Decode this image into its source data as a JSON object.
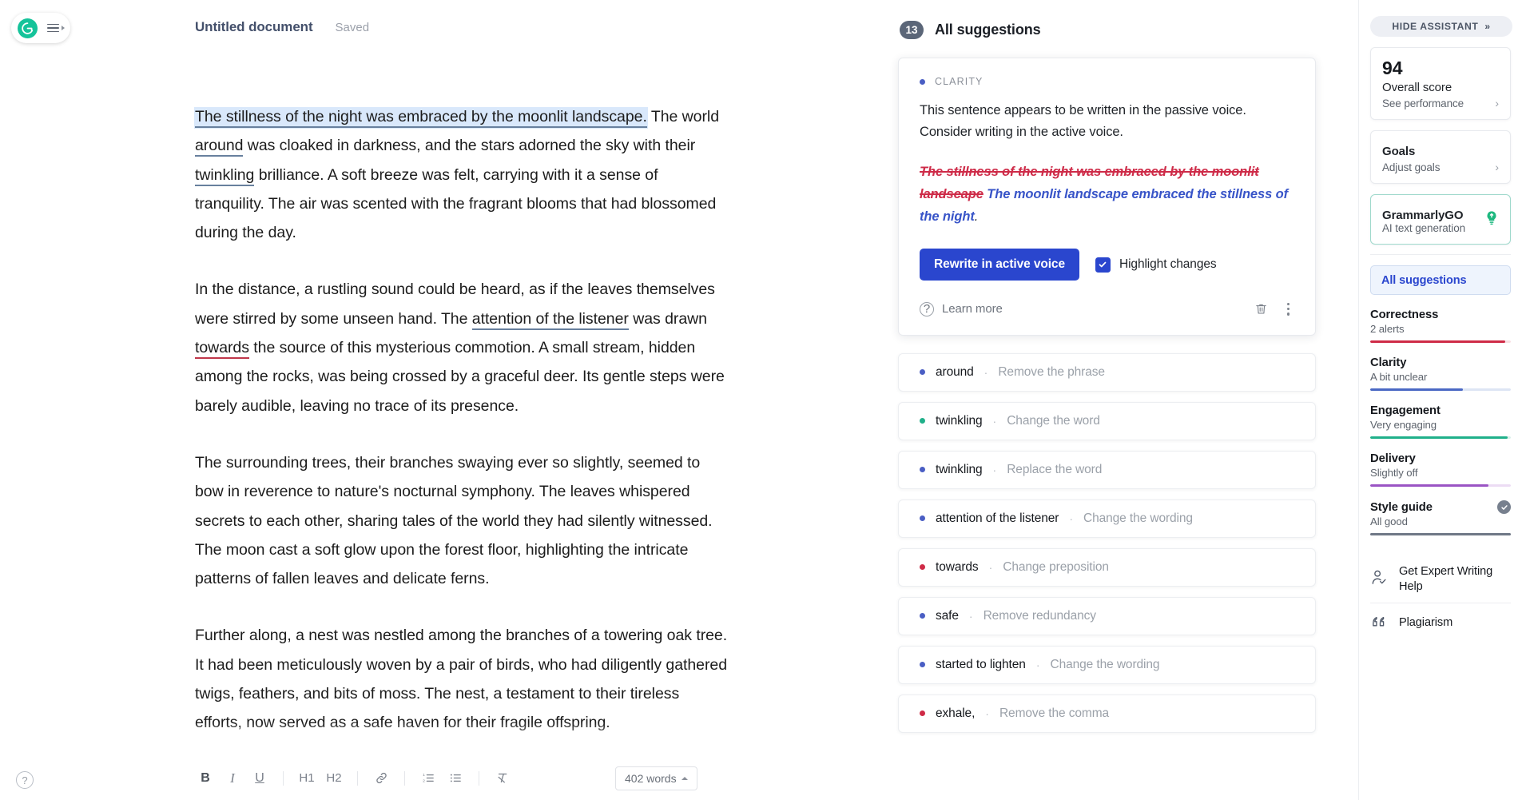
{
  "brand": {
    "logo_letter": "G",
    "logo_color": "#15c39a"
  },
  "document": {
    "title": "Untitled document",
    "save_status": "Saved",
    "paragraphs": [
      {
        "segments": [
          {
            "text": "The stillness of the night was embraced by the moonlit landscape.",
            "style": "highlight-underline"
          },
          {
            "text": " The world ",
            "style": "plain"
          },
          {
            "text": "around",
            "style": "underline-blue"
          },
          {
            "text": " was cloaked in darkness, and the stars adorned the sky with their ",
            "style": "plain"
          },
          {
            "text": "twinkling",
            "style": "underline-blue"
          },
          {
            "text": " brilliance. A soft breeze was felt, carrying with it a sense of tranquility. The air was scented with the fragrant blooms that had blossomed during the day.",
            "style": "plain"
          }
        ]
      },
      {
        "segments": [
          {
            "text": "In the distance, a rustling sound could be heard, as if the leaves themselves were stirred by some unseen hand. The ",
            "style": "plain"
          },
          {
            "text": "attention of the listener",
            "style": "underline-blue"
          },
          {
            "text": " was drawn ",
            "style": "plain"
          },
          {
            "text": "towards",
            "style": "underline-red"
          },
          {
            "text": " the source of this mysterious commotion. A small stream, hidden among the rocks, was being crossed by a graceful deer. Its gentle steps were barely audible, leaving no trace of its presence.",
            "style": "plain"
          }
        ]
      },
      {
        "segments": [
          {
            "text": "The surrounding trees, their branches swaying ever so slightly, seemed to bow in reverence to nature's nocturnal symphony. The leaves whispered secrets to each other, sharing tales of the world they had silently witnessed. The moon cast a soft glow upon the forest floor, highlighting the intricate patterns of fallen leaves and delicate ferns.",
            "style": "plain"
          }
        ]
      },
      {
        "segments": [
          {
            "text": "Further along, a nest was nestled among the branches of a towering oak tree. It had been meticulously woven by a pair of birds, who had diligently gathered twigs, feathers, and bits of moss. The nest, a testament to their tireless efforts, now served as a safe haven for their fragile offspring.",
            "style": "plain"
          }
        ]
      }
    ]
  },
  "toolbar": {
    "bold": "B",
    "italic": "I",
    "underline": "U",
    "h1": "H1",
    "h2": "H2",
    "link_icon": "link-icon",
    "numbered_list_icon": "numbered-list-icon",
    "bullet_list_icon": "bullet-list-icon",
    "clear_format_icon": "clear-formatting-icon",
    "word_count": "402 words",
    "help_icon": "?"
  },
  "suggestions_panel": {
    "count": "13",
    "title": "All suggestions",
    "main_card": {
      "category": "CLARITY",
      "category_color": "#4a5ec4",
      "description": "This sentence appears to be written in the passive voice. Consider writing in the active voice.",
      "diff_old": "The stillness of the night was embraced by the moonlit landscape",
      "diff_new": "The moonlit landscape embraced the stillness of the night",
      "diff_tail": ".",
      "primary_button": "Rewrite in active voice",
      "checkbox_label": "Highlight changes",
      "checkbox_checked": true,
      "learn_more": "Learn more",
      "delete_icon": "trash-icon",
      "more_icon": "kebab-menu-icon"
    },
    "items": [
      {
        "word": "around",
        "sep": "·",
        "action": "Remove the phrase",
        "dot": "#4a5ec4"
      },
      {
        "word": "twinkling",
        "sep": "·",
        "action": "Change the word",
        "dot": "#20b08a"
      },
      {
        "word": "twinkling",
        "sep": "·",
        "action": "Replace the word",
        "dot": "#4a5ec4"
      },
      {
        "word": "attention of the listener",
        "sep": "·",
        "action": "Change the wording",
        "dot": "#4a5ec4"
      },
      {
        "word": "towards",
        "sep": "·",
        "action": "Change preposition",
        "dot": "#cf2b47"
      },
      {
        "word": "safe",
        "sep": "·",
        "action": "Remove redundancy",
        "dot": "#4a5ec4"
      },
      {
        "word": "started to lighten",
        "sep": "·",
        "action": "Change the wording",
        "dot": "#4a5ec4"
      },
      {
        "word": "exhale,",
        "sep": "·",
        "action": "Remove the comma",
        "dot": "#cf2b47"
      }
    ]
  },
  "assistant": {
    "hide_label": "HIDE ASSISTANT",
    "hide_chevron": "»",
    "overall": {
      "score": "94",
      "title": "Overall score",
      "sub": "See performance",
      "chevron": "›"
    },
    "goals": {
      "title": "Goals",
      "sub": "Adjust goals",
      "chevron": "›"
    },
    "grammarlygo": {
      "title": "GrammarlyGO",
      "sub": "AI text generation",
      "icon": "lightbulb-icon",
      "icon_color": "#1db87f"
    },
    "all_suggestions_tab": "All suggestions",
    "metrics": [
      {
        "name": "Correctness",
        "sub": "2 alerts",
        "color": "#cf2b47",
        "track": "#f7dfe3",
        "pct": 96
      },
      {
        "name": "Clarity",
        "sub": "A bit unclear",
        "color": "#4a68c4",
        "track": "#dde5f4",
        "pct": 66
      },
      {
        "name": "Engagement",
        "sub": "Very engaging",
        "color": "#20b08a",
        "track": "#d9f0e9",
        "pct": 98
      },
      {
        "name": "Delivery",
        "sub": "Slightly off",
        "color": "#9a54c4",
        "track": "#ecdcf4",
        "pct": 84
      },
      {
        "name": "Style guide",
        "sub": "All good",
        "color": "#6f7886",
        "track": "#6f7886",
        "pct": 100,
        "badge": "check-badge"
      }
    ],
    "links": [
      {
        "label": "Get Expert Writing Help",
        "icon": "person-check-icon"
      },
      {
        "label": "Plagiarism",
        "icon": "quotation-marks-icon"
      }
    ]
  }
}
